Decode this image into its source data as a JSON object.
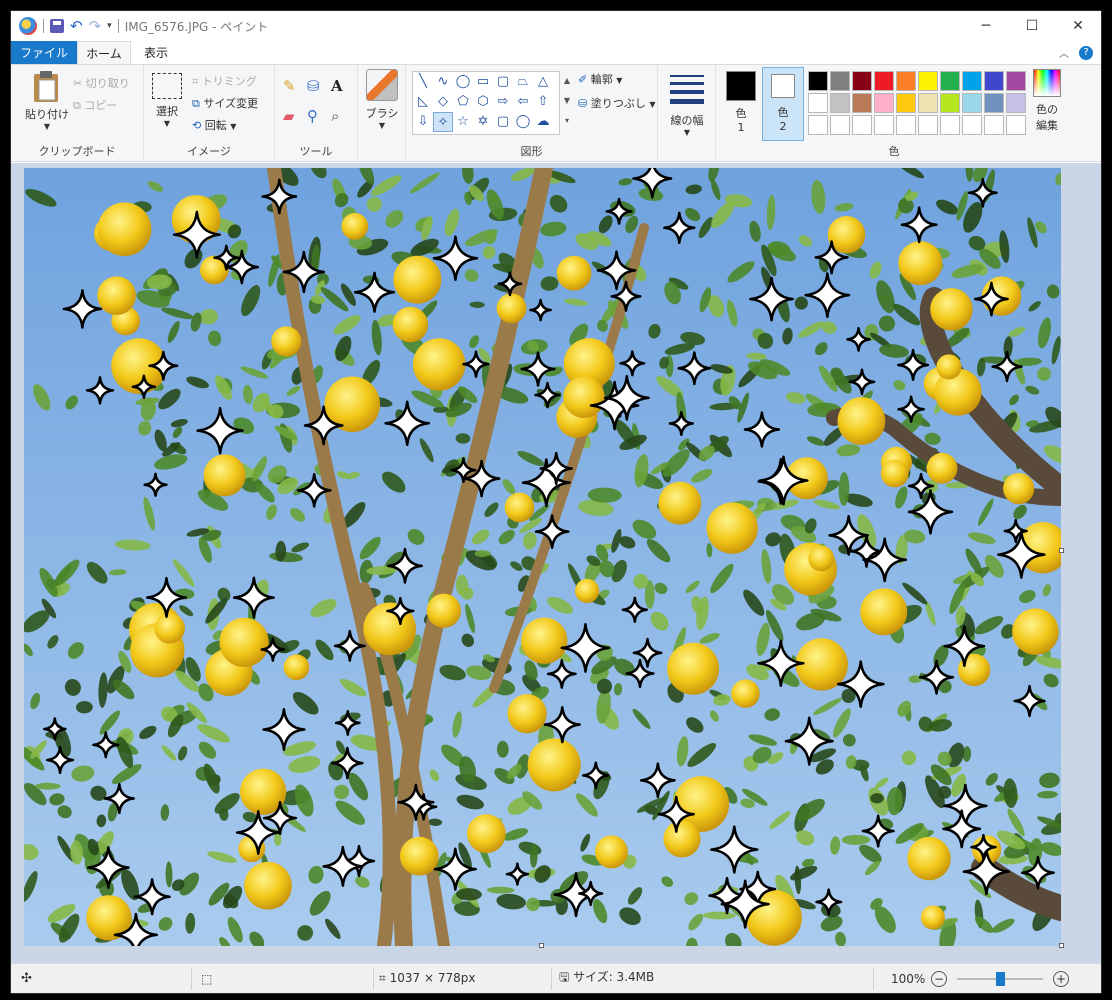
{
  "window": {
    "title": "IMG_6576.JPG - ペイント"
  },
  "tabs": {
    "file": "ファイル",
    "home": "ホーム",
    "view": "表示"
  },
  "clipboard": {
    "paste": "貼り付け",
    "cut": "切り取り",
    "copy": "コピー",
    "group": "クリップボード"
  },
  "image": {
    "select": "選択",
    "crop": "トリミング",
    "resize": "サイズ変更",
    "rotate": "回転",
    "group": "イメージ"
  },
  "tools": {
    "group": "ツール",
    "text_icon": "A"
  },
  "brush": {
    "label": "ブラシ"
  },
  "shapes": {
    "outline": "輪郭",
    "fill": "塗りつぶし",
    "group": "図形"
  },
  "linewidth": {
    "label": "線の幅"
  },
  "colors": {
    "color1": "色",
    "color1_num": "1",
    "color2": "色",
    "color2_num": "2",
    "edit": "色の",
    "edit2": "編集",
    "group": "色",
    "row1": [
      "#000000",
      "#7f7f7f",
      "#880015",
      "#ed1c24",
      "#ff7f27",
      "#fff200",
      "#22b14c",
      "#00a2e8",
      "#3f48cc",
      "#a349a4"
    ],
    "row2": [
      "#ffffff",
      "#c3c3c3",
      "#b97a57",
      "#ffaec9",
      "#ffc90e",
      "#efe4b0",
      "#b5e61d",
      "#99d9ea",
      "#7092be",
      "#c8bfe7"
    ]
  },
  "status": {
    "dimensions": "1037 × 778px",
    "size": "サイズ: 3.4MB",
    "zoom": "100%",
    "zoom_level_percent": 100
  }
}
